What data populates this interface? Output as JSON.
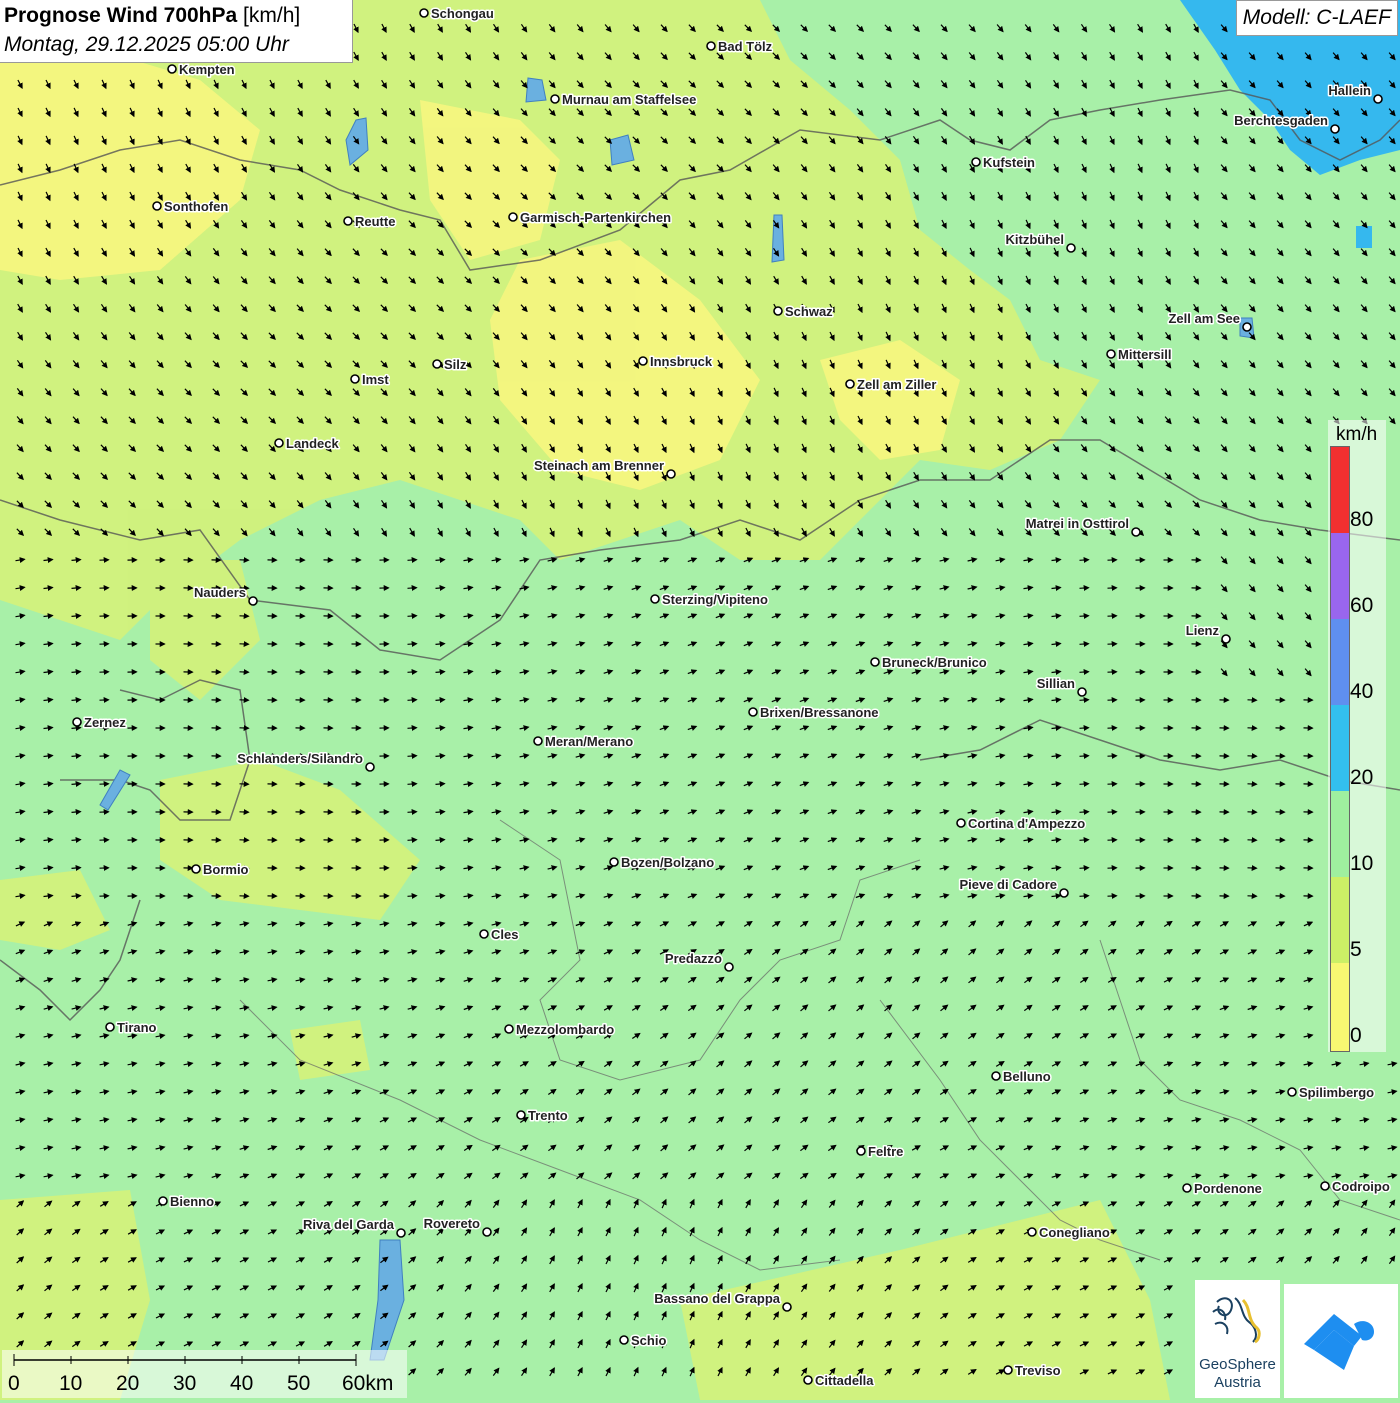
{
  "header": {
    "title_bold": "Prognose Wind 700hPa",
    "title_unit": "[km/h]",
    "datetime": "Montag, 29.12.2025 05:00 Uhr"
  },
  "model": "Modell: C-LAEF",
  "legend": {
    "unit": "km/h",
    "labels": [
      "80",
      "60",
      "40",
      "20",
      "10",
      "5",
      "0"
    ],
    "colors": [
      "#f23030",
      "#9966ee",
      "#5f8ff0",
      "#33bfee",
      "#9ff09f",
      "#ccf066",
      "#f8f872"
    ]
  },
  "scale": {
    "labels": [
      "0",
      "10",
      "20",
      "30",
      "40",
      "50",
      "60km"
    ]
  },
  "logos": {
    "geosphere_line1": "GeoSphere",
    "geosphere_line2": "Austria"
  },
  "cities": [
    {
      "name": "Schongau"
    },
    {
      "name": "Bad Tölz"
    },
    {
      "name": "Kempten"
    },
    {
      "name": "Murnau am Staffelsee"
    },
    {
      "name": "Hallein"
    },
    {
      "name": "Berchtesgaden"
    },
    {
      "name": "Kufstein"
    },
    {
      "name": "Sonthofen"
    },
    {
      "name": "Reutte"
    },
    {
      "name": "Garmisch-Partenkirchen"
    },
    {
      "name": "Kitzbühel"
    },
    {
      "name": "Schwaz"
    },
    {
      "name": "Zell am See"
    },
    {
      "name": "Mittersill"
    },
    {
      "name": "Silz"
    },
    {
      "name": "Innsbruck"
    },
    {
      "name": "Imst"
    },
    {
      "name": "Zell am Ziller"
    },
    {
      "name": "Landeck"
    },
    {
      "name": "Steinach am Brenner"
    },
    {
      "name": "Matrei in Osttirol"
    },
    {
      "name": "Nauders"
    },
    {
      "name": "Sterzing/Vipiteno"
    },
    {
      "name": "Lienz"
    },
    {
      "name": "Bruneck/Brunico"
    },
    {
      "name": "Sillian"
    },
    {
      "name": "Zernez"
    },
    {
      "name": "Brixen/Bressanone"
    },
    {
      "name": "Meran/Merano"
    },
    {
      "name": "Schlanders/Silandro"
    },
    {
      "name": "Cortina d'Ampezzo"
    },
    {
      "name": "Bozen/Bolzano"
    },
    {
      "name": "Bormio"
    },
    {
      "name": "Pieve di Cadore"
    },
    {
      "name": "Cles"
    },
    {
      "name": "Predazzo"
    },
    {
      "name": "Tirano"
    },
    {
      "name": "Mezzolombardo"
    },
    {
      "name": "Belluno"
    },
    {
      "name": "Spilimbergo"
    },
    {
      "name": "Trento"
    },
    {
      "name": "Feltre"
    },
    {
      "name": "Pordenone"
    },
    {
      "name": "Codroipo"
    },
    {
      "name": "Bienno"
    },
    {
      "name": "Riva del Garda"
    },
    {
      "name": "Rovereto"
    },
    {
      "name": "Conegliano"
    },
    {
      "name": "Bassano del Grappa"
    },
    {
      "name": "Schio"
    },
    {
      "name": "Treviso"
    },
    {
      "name": "Cittadella"
    }
  ]
}
